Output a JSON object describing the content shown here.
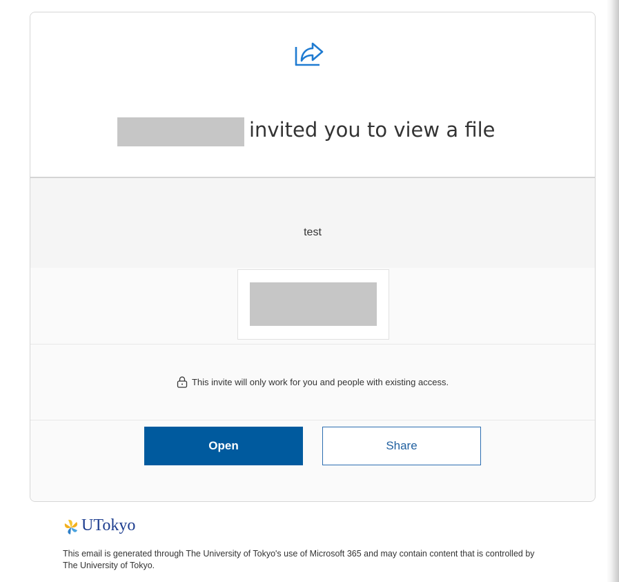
{
  "header": {
    "icon": "share-arrow-icon",
    "title": "invited you to view a file"
  },
  "file": {
    "name": "test"
  },
  "notice": {
    "icon": "lock-icon",
    "text": "This invite will only work for you and people with existing access."
  },
  "buttons": {
    "open_label": "Open",
    "share_label": "Share"
  },
  "footer": {
    "logo_text": "UTokyo",
    "disclaimer": "This email is generated through The University of Tokyo's use of Microsoft 365 and may contain content that is controlled by The University of Tokyo."
  },
  "colors": {
    "primary_button": "#005a9e",
    "accent_icon": "#1f7bd1",
    "logo": "#1d3d8f"
  }
}
